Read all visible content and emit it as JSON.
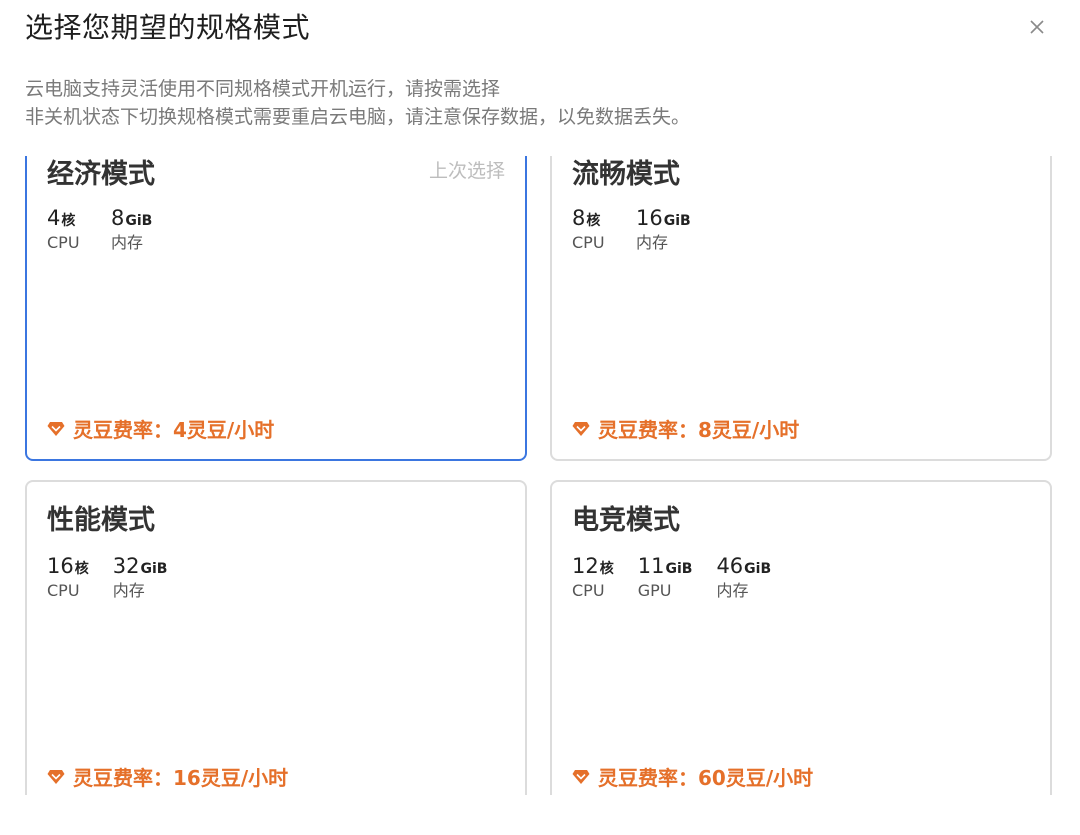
{
  "dialog": {
    "title": "选择您期望的规格模式",
    "close_icon": "close-icon",
    "description_line1": "云电脑支持灵活使用不同规格模式开机运行，请按需选择",
    "description_line2": "非关机状态下切换规格模式需要重启云电脑，请注意保存数据，以免数据丢失。"
  },
  "colors": {
    "accent": "#3b76e0",
    "rate": "#e5702a",
    "border": "#dcdcdc"
  },
  "modes": [
    {
      "name": "经济模式",
      "tag": "上次选择",
      "selected": true,
      "specs": [
        {
          "value": "4",
          "unit": "核",
          "label": "CPU"
        },
        {
          "value": "8",
          "unit": "GiB",
          "label": "内存"
        }
      ],
      "rate": "灵豆费率：4灵豆/小时"
    },
    {
      "name": "流畅模式",
      "selected": false,
      "specs": [
        {
          "value": "8",
          "unit": "核",
          "label": "CPU"
        },
        {
          "value": "16",
          "unit": "GiB",
          "label": "内存"
        }
      ],
      "rate": "灵豆费率：8灵豆/小时"
    },
    {
      "name": "性能模式",
      "selected": false,
      "specs": [
        {
          "value": "16",
          "unit": "核",
          "label": "CPU"
        },
        {
          "value": "32",
          "unit": "GiB",
          "label": "内存"
        }
      ],
      "rate": "灵豆费率：16灵豆/小时"
    },
    {
      "name": "电竞模式",
      "selected": false,
      "specs": [
        {
          "value": "12",
          "unit": "核",
          "label": "CPU"
        },
        {
          "value": "11",
          "unit": "GiB",
          "label": "GPU"
        },
        {
          "value": "46",
          "unit": "GiB",
          "label": "内存"
        }
      ],
      "rate": "灵豆费率：60灵豆/小时"
    }
  ]
}
